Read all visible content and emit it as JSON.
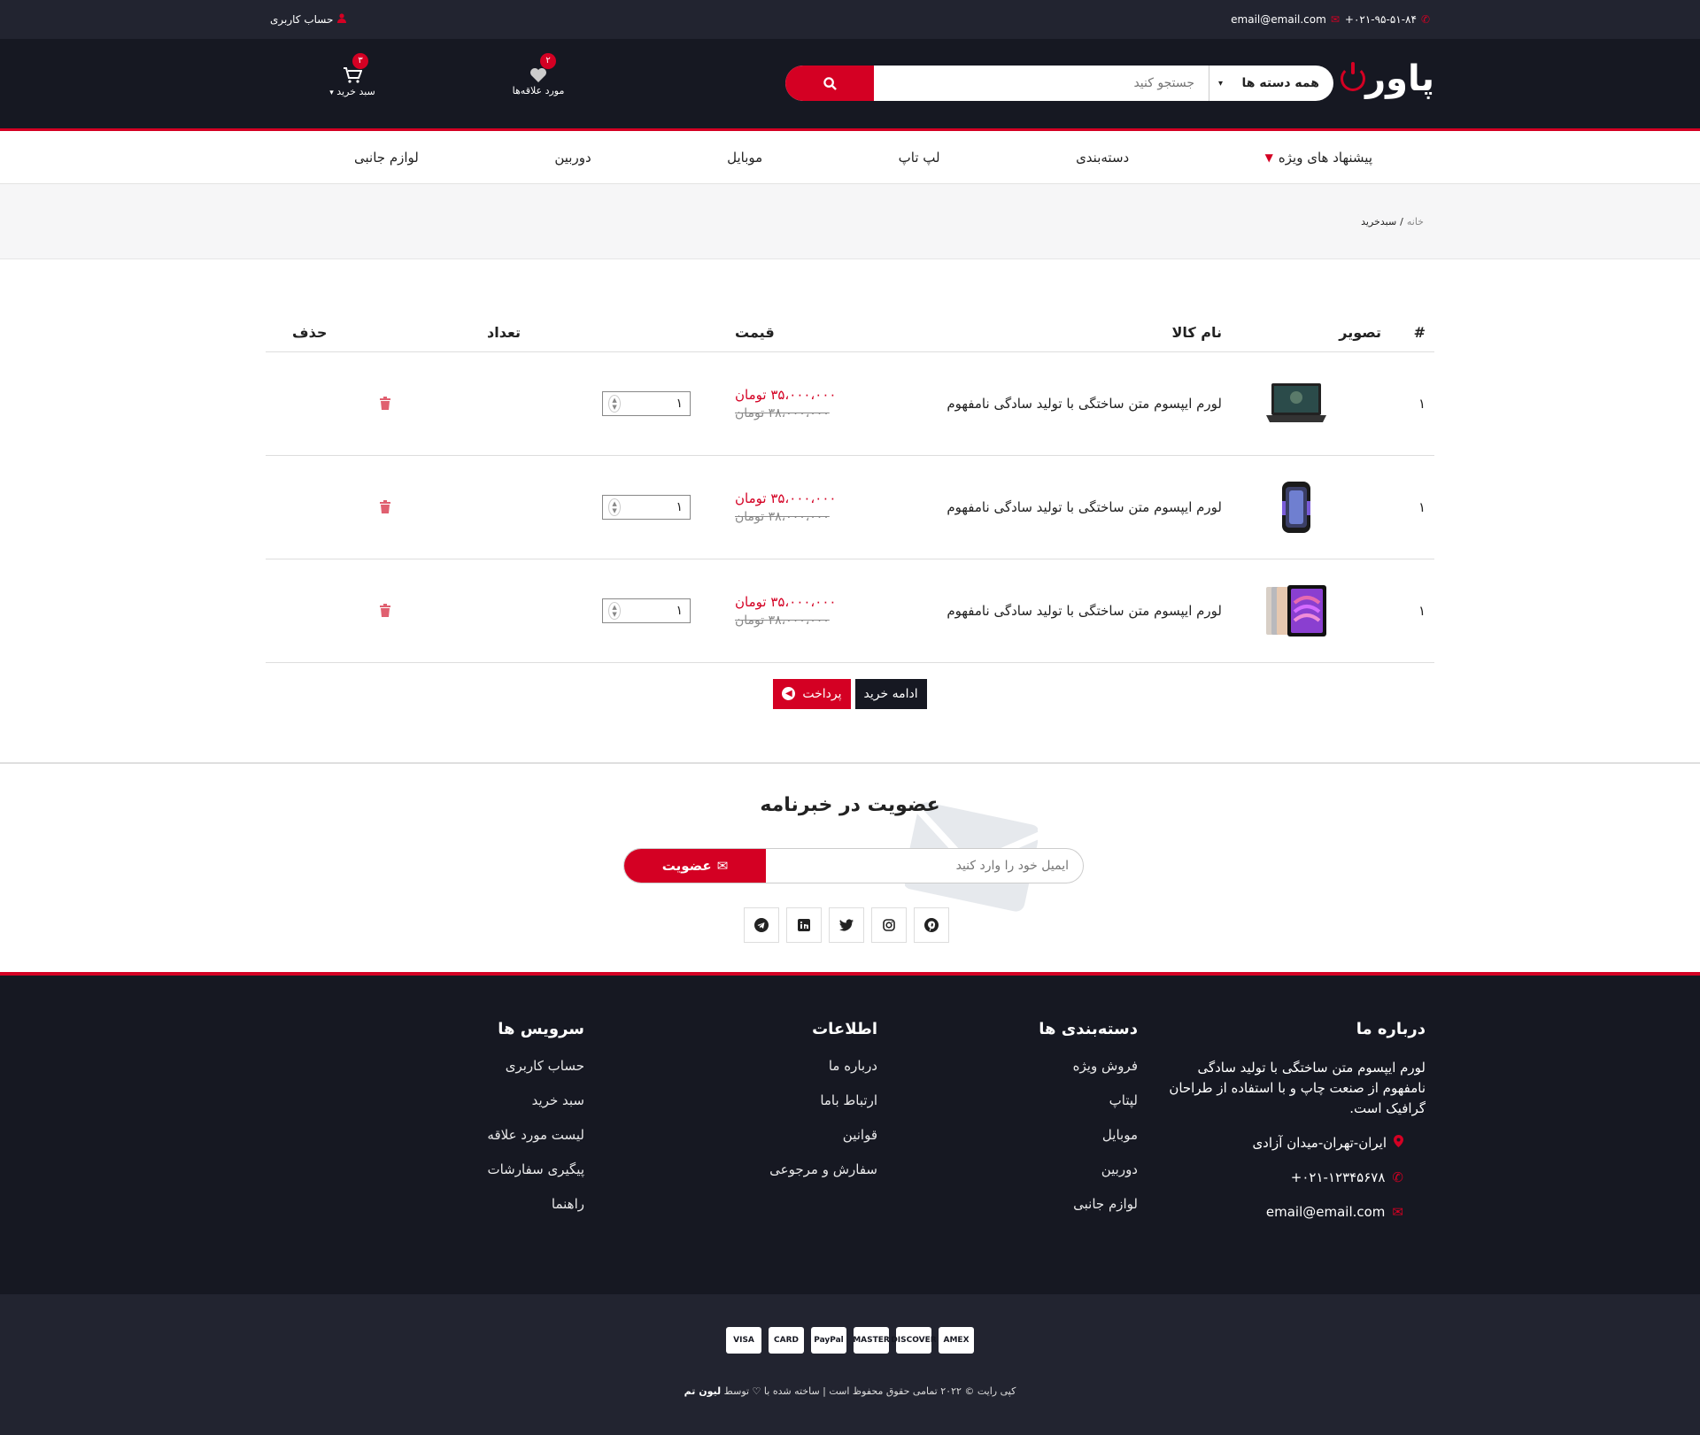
{
  "topbar": {
    "phone": "۰۲۱-۹۵-۵۱-۸۴+",
    "email": "email@email.com",
    "account": "حساب کاربری"
  },
  "header": {
    "logo": "پاور",
    "search_category": "همه دسته ها",
    "search_placeholder": "جستجو کنید",
    "wishlist_label": "مورد علاقه‌ها",
    "wishlist_count": "۲",
    "cart_label": "سبد خرید",
    "cart_count": "۳"
  },
  "nav": {
    "items": [
      "پیشنهاد های ویژه",
      "دسته‌بندی",
      "لپ تاپ",
      "موبایل",
      "دوربین",
      "لوازم جانبی"
    ]
  },
  "breadcrumb": {
    "home": "خانه",
    "current": "سبدخرید"
  },
  "cart": {
    "headers": {
      "num": "#",
      "image": "تصویر",
      "name": "نام کالا",
      "price": "قیمت",
      "qty": "تعداد",
      "delete": "حذف"
    },
    "rows": [
      {
        "num": "۱",
        "image_icon": "laptop-image",
        "name": "لورم ایپسوم متن ساختگی با تولید سادگی نامفهوم",
        "price_new": "۳۵،۰۰۰،۰۰۰ تومان",
        "price_old": "۳۸،۰۰۰،۰۰۰ تومان",
        "qty": "۱"
      },
      {
        "num": "۱",
        "image_icon": "hard-drive-image",
        "name": "لورم ایپسوم متن ساختگی با تولید سادگی نامفهوم",
        "price_new": "۳۵،۰۰۰،۰۰۰ تومان",
        "price_old": "۳۸،۰۰۰،۰۰۰ تومان",
        "qty": "۱"
      },
      {
        "num": "۱",
        "image_icon": "tablet-image",
        "name": "لورم ایپسوم متن ساختگی با تولید سادگی نامفهوم",
        "price_new": "۳۵،۰۰۰،۰۰۰ تومان",
        "price_old": "۳۸،۰۰۰،۰۰۰ تومان",
        "qty": "۱"
      }
    ],
    "continue_label": "ادامه خرید",
    "checkout_label": "پرداخت"
  },
  "newsletter": {
    "title": "عضویت در خبرنامه",
    "placeholder": "ایمیل خود را وارد کنید",
    "submit": "عضویت",
    "social": [
      "telegram-icon",
      "linkedin-icon",
      "twitter-icon",
      "instagram-icon",
      "pinterest-icon"
    ]
  },
  "footer": {
    "about": {
      "title": "درباره ما",
      "text": "لورم ایپسوم متن ساختگی با تولید سادگی نامفهوم از صنعت چاپ و با استفاده از طراحان گرافیک است.",
      "address": "ایران-تهران-میدان آزادی",
      "phone": "۰۲۱-۱۲۳۴۵۶۷۸+",
      "email": "email@email.com"
    },
    "categories": {
      "title": "دسته‌بندی ها",
      "links": [
        "فروش ویژه",
        "لپتاپ",
        "موبایل",
        "دوربین",
        "لوازم جانبی"
      ]
    },
    "info": {
      "title": "اطلاعات",
      "links": [
        "درباره ما",
        "ارتباط باما",
        "قوانین",
        "سفارش و مرجوعی"
      ]
    },
    "services": {
      "title": "سرویس ها",
      "links": [
        "حساب کاربری",
        "سبد خرید",
        "لیست مورد علاقه",
        "پیگیری سفارشات",
        "راهنما"
      ]
    },
    "payments": [
      "VISA",
      "CARD",
      "PayPal",
      "MASTER",
      "DISCOVER",
      "AMEX"
    ],
    "copyright": "کپی رایت © ۲۰۲۲ تمامی حقوق محفوظ است | ساخته شده با ♡ توسط",
    "brand": "لیون تم"
  },
  "colors": {
    "accent": "#d40023",
    "dark": "#161822",
    "topbar": "#222430"
  }
}
